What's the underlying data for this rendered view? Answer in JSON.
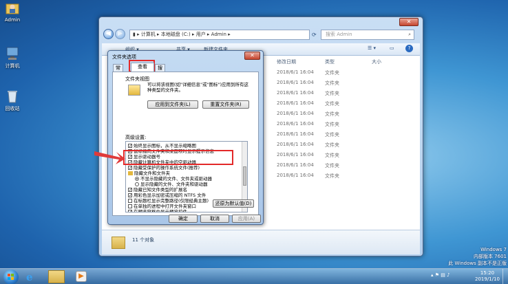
{
  "desktop": {
    "icons": [
      {
        "label": "Admin",
        "icon": "user-folder-icon"
      },
      {
        "label": "计算机",
        "icon": "computer-icon"
      },
      {
        "label": "回收站",
        "icon": "recycle-bin-icon"
      }
    ],
    "watermark": {
      "line1": "Windows 7",
      "line2": "内部版本 7601",
      "line3": "此 Windows 副本不是正版"
    }
  },
  "explorer": {
    "breadcrumb": [
      "计算机",
      "本地磁盘 (C:)",
      "用户",
      "Admin"
    ],
    "search_placeholder": "搜索 Admin",
    "toolbar": {
      "organize": "组织 ▾",
      "share": "共享 ▾",
      "new_folder": "新建文件夹"
    },
    "columns": {
      "date": "修改日期",
      "type": "类型",
      "size": "大小"
    },
    "rows": [
      {
        "date": "2018/6/1 16:04",
        "type": "文件夹"
      },
      {
        "date": "2018/6/1 16:04",
        "type": "文件夹"
      },
      {
        "date": "2018/6/1 16:04",
        "type": "文件夹"
      },
      {
        "date": "2018/6/1 16:04",
        "type": "文件夹"
      },
      {
        "date": "2018/6/1 16:04",
        "type": "文件夹"
      },
      {
        "date": "2018/6/1 16:04",
        "type": "文件夹"
      },
      {
        "date": "2018/6/1 16:04",
        "type": "文件夹"
      },
      {
        "date": "2018/6/1 16:04",
        "type": "文件夹"
      },
      {
        "date": "2018/6/1 16:04",
        "type": "文件夹"
      },
      {
        "date": "2018/6/1 16:04",
        "type": "文件夹"
      },
      {
        "date": "2018/6/1 16:04",
        "type": "文件夹"
      }
    ],
    "status": "11 个对象"
  },
  "dialog": {
    "title": "文件夹选项",
    "tabs": [
      "常规",
      "查看",
      "搜索"
    ],
    "views_group": "文件夹视图",
    "views_desc": "可以将该视图(如\"详细信息\"或\"图标\")应用到所有这种类型的文件夹。",
    "apply_btn": "应用到文件夹(L)",
    "reset_btn": "重置文件夹(R)",
    "advanced_label": "高级设置:",
    "tree_items": [
      {
        "kind": "cb",
        "checked": true,
        "text": "始终显示图标，从不显示缩略图"
      },
      {
        "kind": "cb",
        "checked": true,
        "text": "鼠标指向文件夹和桌面项时显示提示信息"
      },
      {
        "kind": "cb",
        "checked": true,
        "text": "显示驱动器号"
      },
      {
        "kind": "cb",
        "checked": true,
        "text": "隐藏计算机文件夹中的空驱动器"
      },
      {
        "kind": "cb",
        "checked": true,
        "text": "隐藏受保护的操作系统文件(推荐)"
      },
      {
        "kind": "folder",
        "text": "隐藏文件和文件夹"
      },
      {
        "kind": "rb",
        "checked": true,
        "text": "不显示隐藏的文件、文件夹或驱动器"
      },
      {
        "kind": "rb",
        "checked": false,
        "text": "显示隐藏的文件、文件夹和驱动器"
      },
      {
        "kind": "cb",
        "checked": true,
        "text": "隐藏已知文件类型的扩展名"
      },
      {
        "kind": "cb",
        "checked": true,
        "text": "用彩色显示加密或压缩的 NTFS 文件"
      },
      {
        "kind": "cb",
        "checked": false,
        "text": "在标题栏显示完整路径(仅限经典主题)"
      },
      {
        "kind": "cb",
        "checked": false,
        "text": "在单独的进程中打开文件夹窗口"
      },
      {
        "kind": "cb",
        "checked": true,
        "text": "在预览窗格中显示预览控件"
      }
    ],
    "restore_btn": "还原为默认值(D)",
    "ok_btn": "确定",
    "cancel_btn": "取消",
    "apply_bottom_btn": "应用(A)"
  },
  "taskbar": {
    "time": "15:20",
    "date": "2019/1/10"
  },
  "colors": {
    "highlight": "#e32828",
    "arrow": "#e03a3a"
  }
}
